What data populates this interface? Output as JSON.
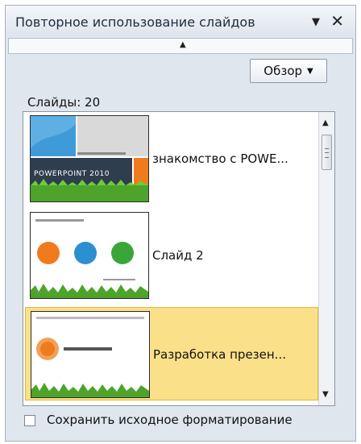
{
  "pane": {
    "title": "Повторное использование слайдов",
    "dropdown_icon": "triangle-down-icon",
    "close_icon": "close-icon",
    "collapse_icon": "triangle-up-icon"
  },
  "browse": {
    "label": "Обзор"
  },
  "slides": {
    "count_label": "Слайды: 20",
    "items": [
      {
        "label": "знакомство с POWE...",
        "thumb_text": "POWERPOINT 2010"
      },
      {
        "label": "Слайд 2",
        "thumb_text": ""
      },
      {
        "label": "Разработка презен...",
        "thumb_text": ""
      }
    ]
  },
  "keep_formatting": {
    "label": "Сохранить исходное форматирование",
    "checked": false
  },
  "colors": {
    "accent_selected": "#fbe08a",
    "pane_bg": "#dfe6ee"
  }
}
